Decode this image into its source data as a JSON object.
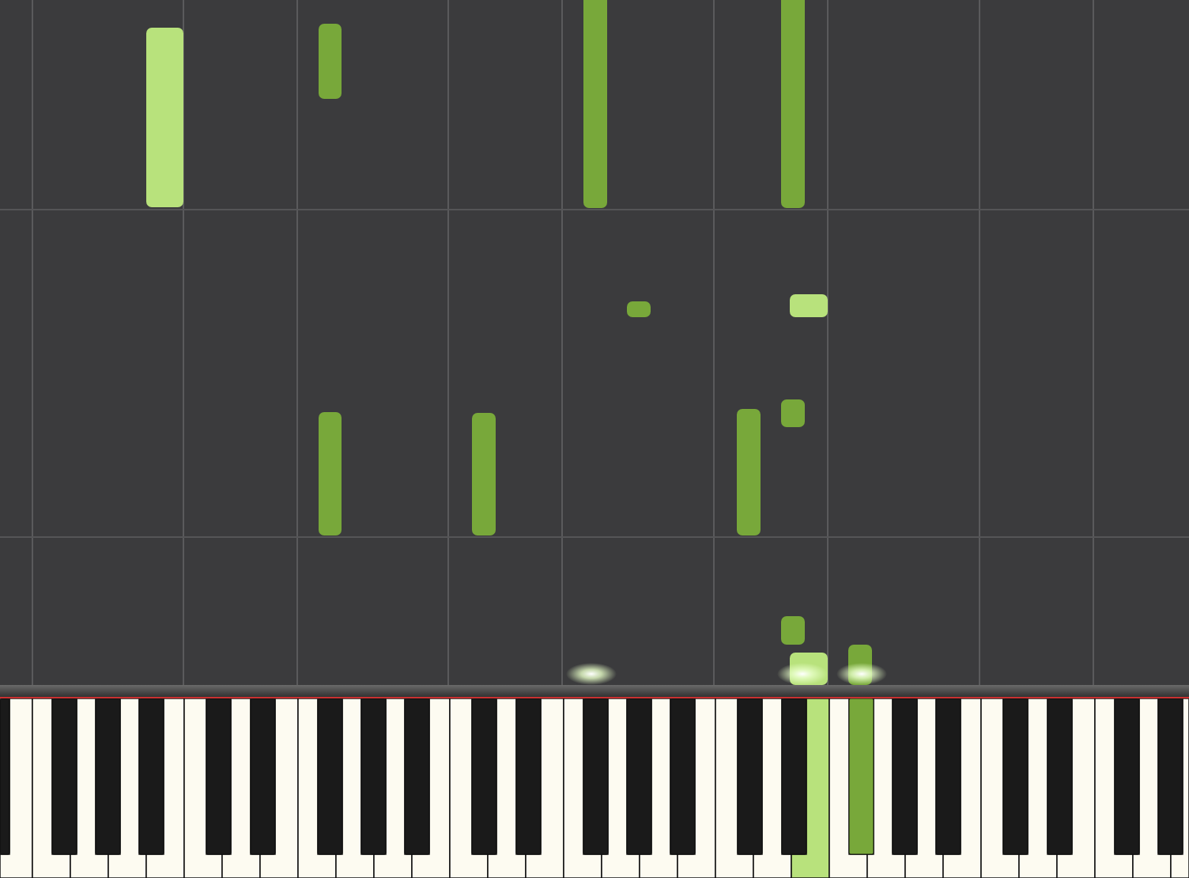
{
  "notes": [
    {
      "color": "#b8e27c"
    },
    {
      "color": "#78a83a"
    },
    {
      "color": "#78a83a"
    },
    {
      "color": "#78a83a"
    },
    {
      "color": "#78a83a"
    },
    {
      "color": "#b8e27c"
    },
    {
      "color": "#78a83a"
    },
    {
      "color": "#78a83a"
    },
    {
      "color": "#78a83a"
    },
    {
      "color": "#78a83a"
    },
    {
      "color": "#78a83a"
    },
    {
      "color": "#b8e27c"
    },
    {
      "color": "#78a83a"
    }
  ],
  "keys": [
    {
      "kind": "black",
      "pressed": false
    },
    {
      "kind": "white",
      "pressed": false
    },
    {
      "kind": "white",
      "pressed": false
    },
    {
      "kind": "black",
      "pressed": false
    },
    {
      "kind": "white",
      "pressed": false
    },
    {
      "kind": "black",
      "pressed": false
    },
    {
      "kind": "white",
      "pressed": false
    },
    {
      "kind": "black",
      "pressed": false
    },
    {
      "kind": "white",
      "pressed": false
    },
    {
      "kind": "white",
      "pressed": false
    },
    {
      "kind": "black",
      "pressed": false
    },
    {
      "kind": "white",
      "pressed": false
    },
    {
      "kind": "black",
      "pressed": false
    },
    {
      "kind": "white",
      "pressed": false
    },
    {
      "kind": "white",
      "pressed": false
    },
    {
      "kind": "black",
      "pressed": false
    },
    {
      "kind": "white",
      "pressed": false
    },
    {
      "kind": "black",
      "pressed": false
    },
    {
      "kind": "white",
      "pressed": false
    },
    {
      "kind": "black",
      "pressed": false
    },
    {
      "kind": "white",
      "pressed": false
    },
    {
      "kind": "white",
      "pressed": false
    },
    {
      "kind": "black",
      "pressed": false
    },
    {
      "kind": "white",
      "pressed": false
    },
    {
      "kind": "black",
      "pressed": false
    },
    {
      "kind": "white",
      "pressed": false
    },
    {
      "kind": "white",
      "pressed": false
    },
    {
      "kind": "black",
      "pressed": false
    },
    {
      "kind": "white",
      "pressed": false
    },
    {
      "kind": "black",
      "pressed": false
    },
    {
      "kind": "white",
      "pressed": false
    },
    {
      "kind": "black",
      "pressed": false
    },
    {
      "kind": "white",
      "pressed": false
    },
    {
      "kind": "white",
      "pressed": false
    },
    {
      "kind": "black",
      "pressed": false
    },
    {
      "kind": "white",
      "pressed": false
    },
    {
      "kind": "black",
      "pressed": false
    },
    {
      "kind": "white",
      "pressed": true,
      "color": "#b8e27c"
    },
    {
      "kind": "white",
      "pressed": false
    },
    {
      "kind": "black",
      "pressed": true,
      "color": "#78a83a"
    },
    {
      "kind": "white",
      "pressed": false
    },
    {
      "kind": "black",
      "pressed": false
    },
    {
      "kind": "white",
      "pressed": false
    },
    {
      "kind": "black",
      "pressed": false
    },
    {
      "kind": "white",
      "pressed": false
    },
    {
      "kind": "white",
      "pressed": false
    },
    {
      "kind": "black",
      "pressed": false
    },
    {
      "kind": "white",
      "pressed": false
    },
    {
      "kind": "black",
      "pressed": false
    },
    {
      "kind": "white",
      "pressed": false
    },
    {
      "kind": "white",
      "pressed": false
    },
    {
      "kind": "black",
      "pressed": false
    },
    {
      "kind": "white",
      "pressed": false
    },
    {
      "kind": "black",
      "pressed": false
    },
    {
      "kind": "white",
      "pressed": false
    }
  ]
}
